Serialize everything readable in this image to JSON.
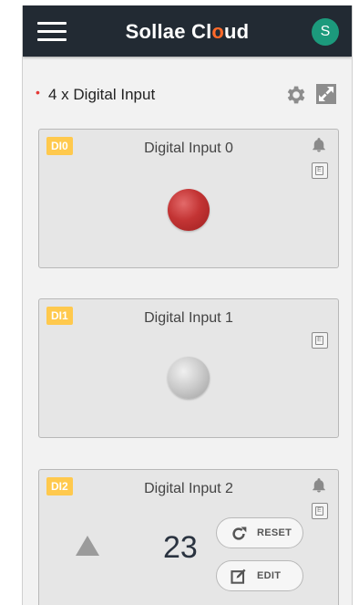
{
  "app": {
    "brand_left": "Sollae Cl",
    "brand_o": "o",
    "brand_right": "ud",
    "user_initial": "S"
  },
  "widget": {
    "required_marker": "•",
    "title": "4 x Digital Input"
  },
  "inputs": [
    {
      "tag": "DI0",
      "label": "Digital Input 0",
      "state": "on",
      "has_bell": true
    },
    {
      "tag": "DI1",
      "label": "Digital Input 1",
      "state": "off",
      "has_bell": false
    },
    {
      "tag": "DI2",
      "label": "Digital Input 2",
      "count": "23",
      "has_bell": true,
      "reset_label": "RESET",
      "edit_label": "EDIT"
    }
  ],
  "event_icon_letter": "E",
  "colors": {
    "appbar": "#222a33",
    "accent_o": "#ff6a2a",
    "avatar": "#1c9a7c",
    "tag": "#ffc94d",
    "led_on": "#c33434"
  }
}
